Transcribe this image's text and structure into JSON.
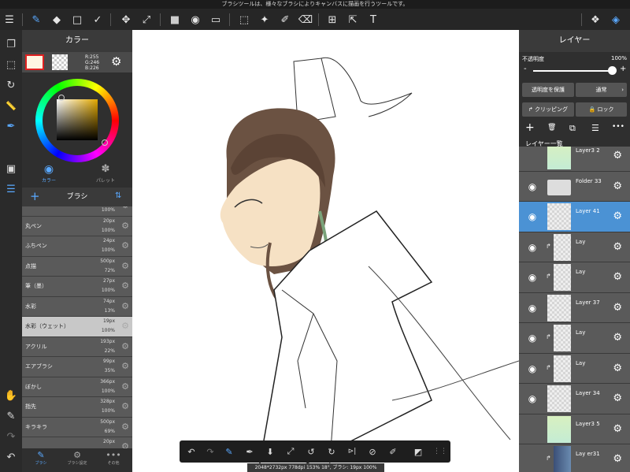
{
  "top_message": "ブラシツールは、様々なブラシによりキャンバスに描画を行うツールです。",
  "toolbar": {
    "menu_icon": "☰",
    "brush_icon": "✎",
    "eraser_icon": "◆",
    "rect_icon": "□",
    "correction_icon": "✓",
    "move_icon": "✥",
    "transform_icon": "⤢",
    "fill_color_icon": "■",
    "bucket_icon": "◉",
    "gradient_icon": "▭",
    "select_rect_icon": "⬚",
    "magic_wand_icon": "✦",
    "select_pen_icon": "✐",
    "select_eraser_icon": "⌫",
    "divider_icon": "⊞",
    "operation_icon": "⇱",
    "text_icon": "T",
    "materials_icon": "❖",
    "layers_icon": "◈"
  },
  "left_strip": {
    "pages_icon": "❐",
    "select_icon": "⬚",
    "rotate_icon": "↻",
    "ruler_icon": "📏",
    "eyedrop_icon": "✒",
    "color_toggle_icon": "▣",
    "layers_icon": "☰",
    "hand_icon": "✋",
    "pen_icon": "✎",
    "redo_icon": "↷",
    "undo_icon": "↶"
  },
  "color_panel": {
    "title": "カラー",
    "rgb": {
      "r": "R:255",
      "g": "G:246",
      "b": "B:226"
    },
    "primary_color": "#fff6e2",
    "gear_icon": "⚙",
    "tab_color": "カラー",
    "tab_palette": "パレット"
  },
  "brush_panel": {
    "title": "ブラシ",
    "add_icon": "+",
    "sort_icon": "⇅",
    "items": [
      {
        "name": "",
        "size": "",
        "opacity": "100%"
      },
      {
        "name": "丸ペン",
        "size": "20px",
        "opacity": "100%"
      },
      {
        "name": "ふちペン",
        "size": "24px",
        "opacity": "100%"
      },
      {
        "name": "点描",
        "size": "500px",
        "opacity": "72%"
      },
      {
        "name": "筆（墨）",
        "size": "27px",
        "opacity": "100%"
      },
      {
        "name": "水彩",
        "size": "74px",
        "opacity": "13%"
      },
      {
        "name": "水彩（ウェット）",
        "size": "19px",
        "opacity": "100%"
      },
      {
        "name": "アクリル",
        "size": "193px",
        "opacity": "22%"
      },
      {
        "name": "エアブラシ",
        "size": "99px",
        "opacity": "35%"
      },
      {
        "name": "ぼかし",
        "size": "366px",
        "opacity": "100%"
      },
      {
        "name": "指先",
        "size": "328px",
        "opacity": "100%"
      },
      {
        "name": "キラキラ",
        "size": "500px",
        "opacity": "69%"
      },
      {
        "name": "",
        "size": "20px",
        "opacity": ""
      }
    ],
    "footer": {
      "brush": "ブラシ",
      "brush_settings": "ブラシ設定",
      "other": "その他"
    }
  },
  "quickbar": {
    "undo": "↶",
    "redo": "↷",
    "brush": "✎",
    "eyedropper": "✒",
    "fill": "⬇",
    "transform": "⤢",
    "rotate_left": "↺",
    "rotate_right": "↻",
    "flip": "⊳|",
    "no_snap": "⊘",
    "edit": "✐",
    "color": "◩",
    "grid": "⋮⋮"
  },
  "status": "2048*2732px 778dpi 153% 18°, ブラシ: 19px 100%",
  "layer_panel": {
    "title": "レイヤー",
    "opacity_label": "不透明度",
    "opacity_value": "100%",
    "opacity": 1.0,
    "minus": "-",
    "plus": "+",
    "protect_alpha": "透明度を保護",
    "blend_mode": "通常",
    "clipping": "クリッピング",
    "lock": "ロック",
    "list_label": "レイヤー一覧",
    "add_icon": "+",
    "trash_icon": "🗑",
    "copy_icon": "⧉",
    "list_icon": "☰",
    "more_icon": "•••",
    "layers": [
      {
        "name": "Layer3 2",
        "visible": "",
        "clip": "",
        "thumb": "green"
      },
      {
        "name": "Folder 33",
        "visible": "◉",
        "clip": "",
        "thumb": "folder"
      },
      {
        "name": "Layer 41",
        "visible": "◉",
        "clip": "",
        "thumb": "checker"
      },
      {
        "name": "Lay",
        "visible": "◉",
        "clip": "↱",
        "thumb": "checker"
      },
      {
        "name": "Lay",
        "visible": "◉",
        "clip": "↱",
        "thumb": "checker"
      },
      {
        "name": "Layer 37",
        "visible": "◉",
        "clip": "",
        "thumb": "checker"
      },
      {
        "name": "Lay",
        "visible": "◉",
        "clip": "↱",
        "thumb": "checker"
      },
      {
        "name": "Lay",
        "visible": "◉",
        "clip": "↱",
        "thumb": "checker"
      },
      {
        "name": "Layer 34",
        "visible": "◉",
        "clip": "",
        "thumb": "checker"
      },
      {
        "name": "Layer3 5",
        "visible": "",
        "clip": "",
        "thumb": "green"
      },
      {
        "name": "Lay er31",
        "visible": "",
        "clip": "↱",
        "thumb": "blue"
      }
    ]
  }
}
